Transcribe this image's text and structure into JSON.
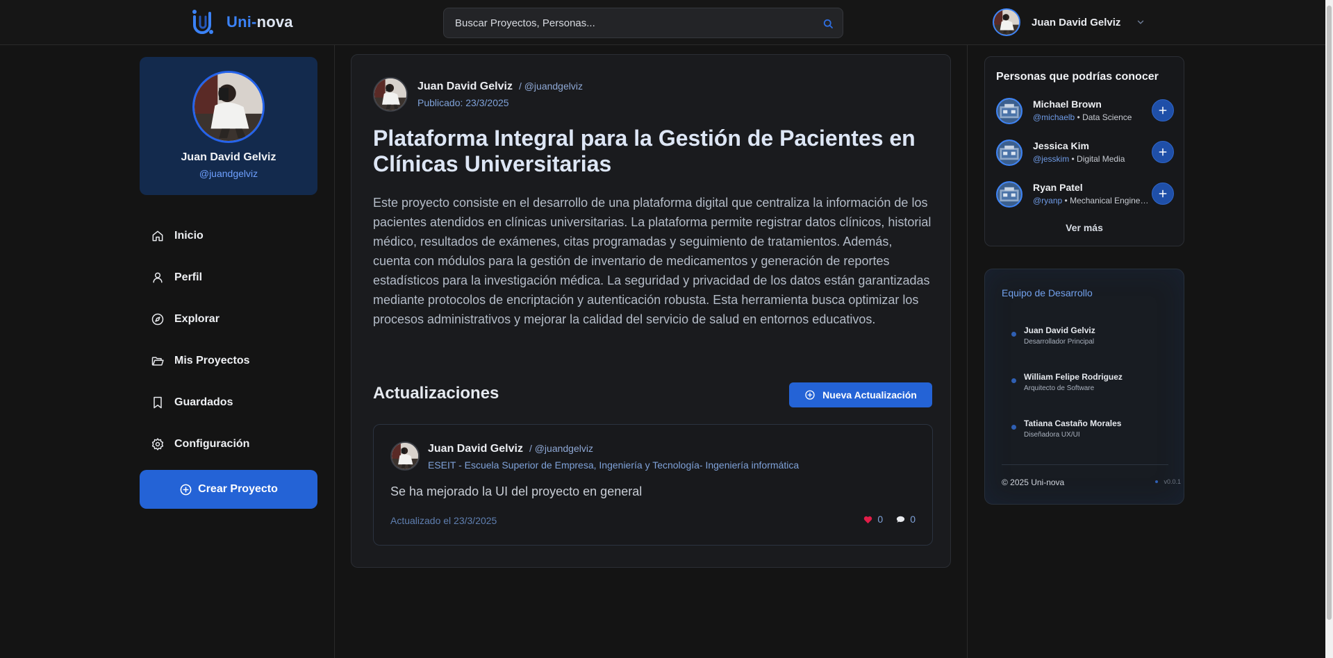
{
  "brand": {
    "name_part1": "Uni-",
    "name_part2": "nova",
    "accent_color": "#3b82f6",
    "logo_icon": "logo-u-icon"
  },
  "search": {
    "placeholder": "Buscar Proyectos, Personas...",
    "icon": "search-icon"
  },
  "user_menu": {
    "name": "Juan David Gelviz",
    "icon": "chevron-down-icon"
  },
  "profile": {
    "name": "Juan David Gelviz",
    "handle": "@juandgelviz"
  },
  "nav": {
    "items": [
      {
        "label": "Inicio",
        "icon": "home-icon"
      },
      {
        "label": "Perfil",
        "icon": "user-icon"
      },
      {
        "label": "Explorar",
        "icon": "compass-icon"
      },
      {
        "label": "Mis Proyectos",
        "icon": "folder-icon"
      },
      {
        "label": "Guardados",
        "icon": "bookmark-icon"
      },
      {
        "label": "Configuración",
        "icon": "gear-icon"
      }
    ],
    "create_label": "Crear Proyecto"
  },
  "post": {
    "author": "Juan David Gelviz",
    "handle": "/ @juandgelviz",
    "published": "Publicado: 23/3/2025",
    "title": "Plataforma Integral para la Gestión de Pacientes en Clínicas Universitarias",
    "description": "Este proyecto consiste en el desarrollo de una plataforma digital que centraliza la información de los pacientes atendidos en clínicas universitarias. La plataforma permite registrar datos clínicos, historial médico, resultados de exámenes, citas programadas y seguimiento de tratamientos. Además, cuenta con módulos para la gestión de inventario de medicamentos y generación de reportes estadísticos para la investigación médica. La seguridad y privacidad de los datos están garantizadas mediante protocolos de encriptación y autenticación robusta. Esta herramienta busca optimizar los procesos administrativos y mejorar la calidad del servicio de salud en entornos educativos."
  },
  "updates": {
    "title": "Actualizaciones",
    "new_button": "Nueva Actualización",
    "items": [
      {
        "author": "Juan David Gelviz",
        "handle": "/ @juandgelviz",
        "institution": "ESEIT - Escuela Superior de Empresa, Ingeniería y Tecnología- Ingeniería informática",
        "content": "Se ha mejorado la UI del proyecto en general",
        "date": "Actualizado el 23/3/2025",
        "likes": "0",
        "comments": "0",
        "like_color": "#e11d48"
      }
    ]
  },
  "suggestions": {
    "title": "Personas que podrías conocer",
    "people": [
      {
        "name": "Michael Brown",
        "handle": "@michaelb",
        "field": " • Data Science"
      },
      {
        "name": "Jessica Kim",
        "handle": "@jesskim",
        "field": " • Digital Media"
      },
      {
        "name": "Ryan Patel",
        "handle": "@ryanp",
        "field": " • Mechanical Engineering"
      }
    ],
    "see_more": "Ver más"
  },
  "team": {
    "title": "Equipo de Desarrollo",
    "members": [
      {
        "name": "Juan David Gelviz",
        "role": "Desarrollador Principal"
      },
      {
        "name": "William Felipe Rodriguez",
        "role": "Arquitecto de Software"
      },
      {
        "name": "Tatiana Castaño Morales",
        "role": "Diseñadora UX/UI"
      }
    ],
    "copyright": "© 2025 Uni-nova",
    "version": "v0.0.1"
  }
}
